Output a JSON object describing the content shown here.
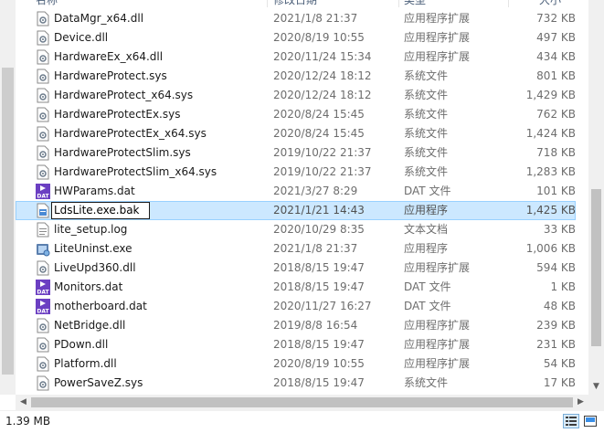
{
  "header": {
    "columns": [
      "名称",
      "修改日期",
      "类型",
      "大小"
    ]
  },
  "files": [
    {
      "name": "DataMgr_x64.dll",
      "date": "2021/1/8 21:37",
      "type": "应用程序扩展",
      "size": "732 KB",
      "icon": "dll-file-icon"
    },
    {
      "name": "Device.dll",
      "date": "2020/8/19 10:55",
      "type": "应用程序扩展",
      "size": "497 KB",
      "icon": "dll-file-icon"
    },
    {
      "name": "HardwareEx_x64.dll",
      "date": "2020/11/24 15:34",
      "type": "应用程序扩展",
      "size": "434 KB",
      "icon": "dll-file-icon"
    },
    {
      "name": "HardwareProtect.sys",
      "date": "2020/12/24 18:12",
      "type": "系统文件",
      "size": "801 KB",
      "icon": "sys-file-icon"
    },
    {
      "name": "HardwareProtect_x64.sys",
      "date": "2020/12/24 18:12",
      "type": "系统文件",
      "size": "1,429 KB",
      "icon": "sys-file-icon"
    },
    {
      "name": "HardwareProtectEx.sys",
      "date": "2020/8/24 15:45",
      "type": "系统文件",
      "size": "762 KB",
      "icon": "sys-file-icon"
    },
    {
      "name": "HardwareProtectEx_x64.sys",
      "date": "2020/8/24 15:45",
      "type": "系统文件",
      "size": "1,424 KB",
      "icon": "sys-file-icon"
    },
    {
      "name": "HardwareProtectSlim.sys",
      "date": "2019/10/22 21:37",
      "type": "系统文件",
      "size": "718 KB",
      "icon": "sys-file-icon"
    },
    {
      "name": "HardwareProtectSlim_x64.sys",
      "date": "2019/10/22 21:37",
      "type": "系统文件",
      "size": "1,283 KB",
      "icon": "sys-file-icon"
    },
    {
      "name": "HWParams.dat",
      "date": "2021/3/27 8:29",
      "type": "DAT 文件",
      "size": "101 KB",
      "icon": "dat-file-icon"
    },
    {
      "name": "LdsLite.exe.bak",
      "date": "2021/1/21 14:43",
      "type": "应用程序",
      "size": "1,425 KB",
      "icon": "exe-file-icon",
      "selected": true
    },
    {
      "name": "lite_setup.log",
      "date": "2020/10/29 8:35",
      "type": "文本文档",
      "size": "33 KB",
      "icon": "text-file-icon"
    },
    {
      "name": "LiteUninst.exe",
      "date": "2021/1/8 21:37",
      "type": "应用程序",
      "size": "1,006 KB",
      "icon": "uninstall-exe-icon"
    },
    {
      "name": "LiveUpd360.dll",
      "date": "2018/8/15 19:47",
      "type": "应用程序扩展",
      "size": "594 KB",
      "icon": "dll-file-icon"
    },
    {
      "name": "Monitors.dat",
      "date": "2018/8/15 19:47",
      "type": "DAT 文件",
      "size": "1 KB",
      "icon": "dat-file-icon"
    },
    {
      "name": "motherboard.dat",
      "date": "2020/11/27 16:27",
      "type": "DAT 文件",
      "size": "48 KB",
      "icon": "dat-file-icon"
    },
    {
      "name": "NetBridge.dll",
      "date": "2019/8/8 16:54",
      "type": "应用程序扩展",
      "size": "239 KB",
      "icon": "dll-file-icon"
    },
    {
      "name": "PDown.dll",
      "date": "2018/8/15 19:47",
      "type": "应用程序扩展",
      "size": "231 KB",
      "icon": "dll-file-icon"
    },
    {
      "name": "Platform.dll",
      "date": "2020/8/19 10:55",
      "type": "应用程序扩展",
      "size": "54 KB",
      "icon": "dll-file-icon"
    },
    {
      "name": "PowerSaveZ.sys",
      "date": "2018/8/15 19:47",
      "type": "系统文件",
      "size": "17 KB",
      "icon": "sys-file-icon"
    }
  ],
  "rename": {
    "value": "LdsLite.exe.bak"
  },
  "statusbar": {
    "text": "1.39 MB"
  },
  "colors": {
    "selection": "#cce8ff",
    "selection_border": "#99d1ff",
    "dat_purple": "#6b3fc2"
  }
}
